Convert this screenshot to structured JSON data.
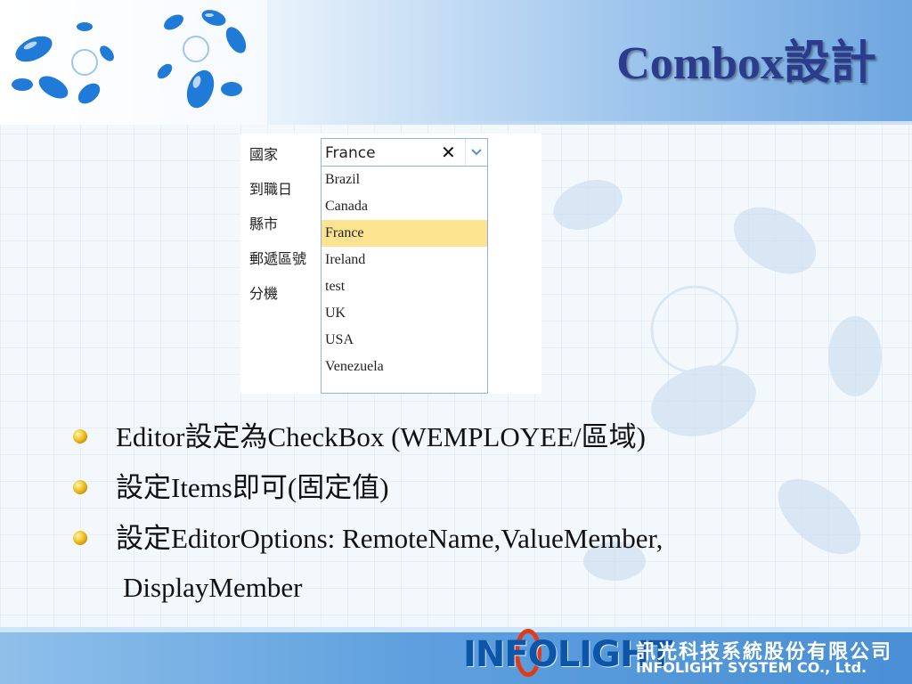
{
  "slide": {
    "title": "Combox設計"
  },
  "form": {
    "labels": [
      "國家",
      "到職日",
      "縣市",
      "郵遞區號",
      "分機"
    ],
    "combo": {
      "value": "France"
    },
    "options": [
      "Brazil",
      "Canada",
      "France",
      "Ireland",
      "test",
      "UK",
      "USA",
      "Venezuela"
    ],
    "selected": "France",
    "icons": {
      "clear": "close-icon",
      "dropdown": "chevron-down-icon"
    }
  },
  "bullets": [
    "Editor設定為CheckBox (WEMPLOYEE/區域)",
    "設定Items即可(固定值)",
    "設定EditorOptions: RemoteName,ValueMember,"
  ],
  "bullet_continuation": "DisplayMember",
  "footer": {
    "brand": "INFOLIGHT",
    "company_cn": "訊光科技系統股份有限公司",
    "company_en": "INFOLIGHT SYSTEM CO., Ltd."
  },
  "colors": {
    "title": "#2b3c8c",
    "highlight": "#fbe38f",
    "accent": "#0c55a8",
    "footer": "#5ea0de"
  }
}
